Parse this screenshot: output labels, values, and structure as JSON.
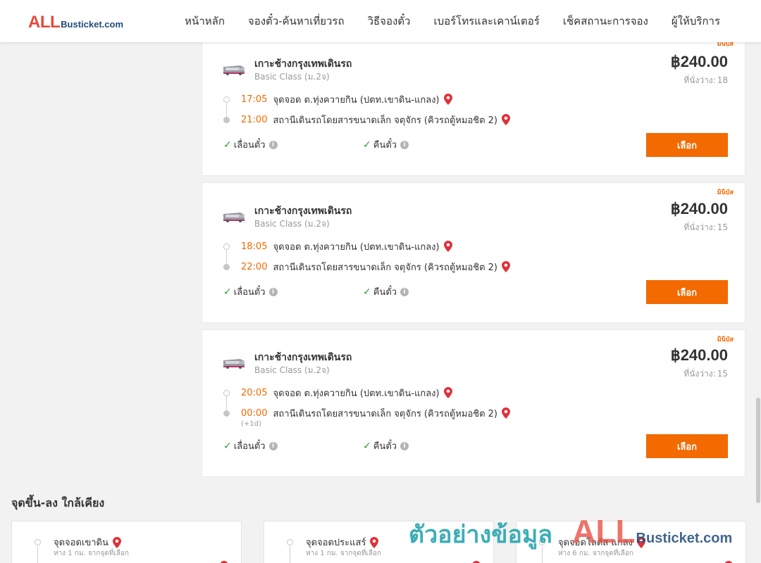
{
  "header": {
    "logo": {
      "all": "ALL",
      "busticket": "Busticket.com"
    },
    "nav": [
      "หน้าหลัก",
      "จองตั๋ว-ค้นหาเที่ยวรถ",
      "วิธีจองตั๋ว",
      "เบอร์โทรและเคาน์เตอร์",
      "เช็คสถานะการจอง",
      "ผู้ให้บริการ"
    ]
  },
  "trips": [
    {
      "badge": "มินิบัส",
      "route": "เกาะช้างกรุงเทพเดินรถ",
      "class": "Basic Class (ม.2จ)",
      "price": "฿240.00",
      "seats_label": "ที่นั่งว่าง:",
      "seats": "18",
      "dep_time": "17:05",
      "dep_place": "จุดจอด ต.ทุ่งควายกิน (ปตท.เขาดิน-แกลง)",
      "arr_time": "21:00",
      "arr_place": "สถานีเดินรถโดยสารขนาดเล็ก จตุจักร (คิวรถตู้หมอชิต 2)",
      "arr_note": "",
      "feature1": "เลื่อนตั๋ว",
      "feature2": "คืนตั๋ว",
      "button": "เลือก"
    },
    {
      "badge": "มินิบัส",
      "route": "เกาะช้างกรุงเทพเดินรถ",
      "class": "Basic Class (ม.2จ)",
      "price": "฿240.00",
      "seats_label": "ที่นั่งว่าง:",
      "seats": "15",
      "dep_time": "18:05",
      "dep_place": "จุดจอด ต.ทุ่งควายกิน (ปตท.เขาดิน-แกลง)",
      "arr_time": "22:00",
      "arr_place": "สถานีเดินรถโดยสารขนาดเล็ก จตุจักร (คิวรถตู้หมอชิต 2)",
      "arr_note": "",
      "feature1": "เลื่อนตั๋ว",
      "feature2": "คืนตั๋ว",
      "button": "เลือก"
    },
    {
      "badge": "มินิบัส",
      "route": "เกาะช้างกรุงเทพเดินรถ",
      "class": "Basic Class (ม.2จ)",
      "price": "฿240.00",
      "seats_label": "ที่นั่งว่าง:",
      "seats": "15",
      "dep_time": "20:05",
      "dep_place": "จุดจอด ต.ทุ่งควายกิน (ปตท.เขาดิน-แกลง)",
      "arr_time": "00:00",
      "arr_place": "สถานีเดินรถโดยสารขนาดเล็ก จตุจักร (คิวรถตู้หมอชิต 2)",
      "arr_note": "(+1d)",
      "feature1": "เลื่อนตั๋ว",
      "feature2": "คืนตั๋ว",
      "button": "เลือก"
    }
  ],
  "nearby": {
    "title": "จุดขึ้น-ลง ใกล้เคียง",
    "items": [
      {
        "name": "จุดจอดเขาดิน",
        "distance": "ห่าง 1 กม. จากจุดที่เลือก"
      },
      {
        "name": "จุดจอดประแสร์",
        "distance": "ห่าง 1 กม. จากจุดที่เลือก"
      },
      {
        "name": "จุดจอดโลตัส แกลง",
        "distance": "ห่าง 6 กม. จากจุดที่เลือก"
      }
    ]
  },
  "watermark": {
    "text": "ตัวอย่างข้อมูล",
    "all": "ALL",
    "busticket": "Busticket.com"
  },
  "colors": {
    "accent": "#f36a00",
    "pin": "#e0303a",
    "check": "#2e9b3a",
    "logo_red": "#e8483a",
    "logo_blue": "#1f4b7a",
    "watermark_teal": "#1aa0aa"
  }
}
